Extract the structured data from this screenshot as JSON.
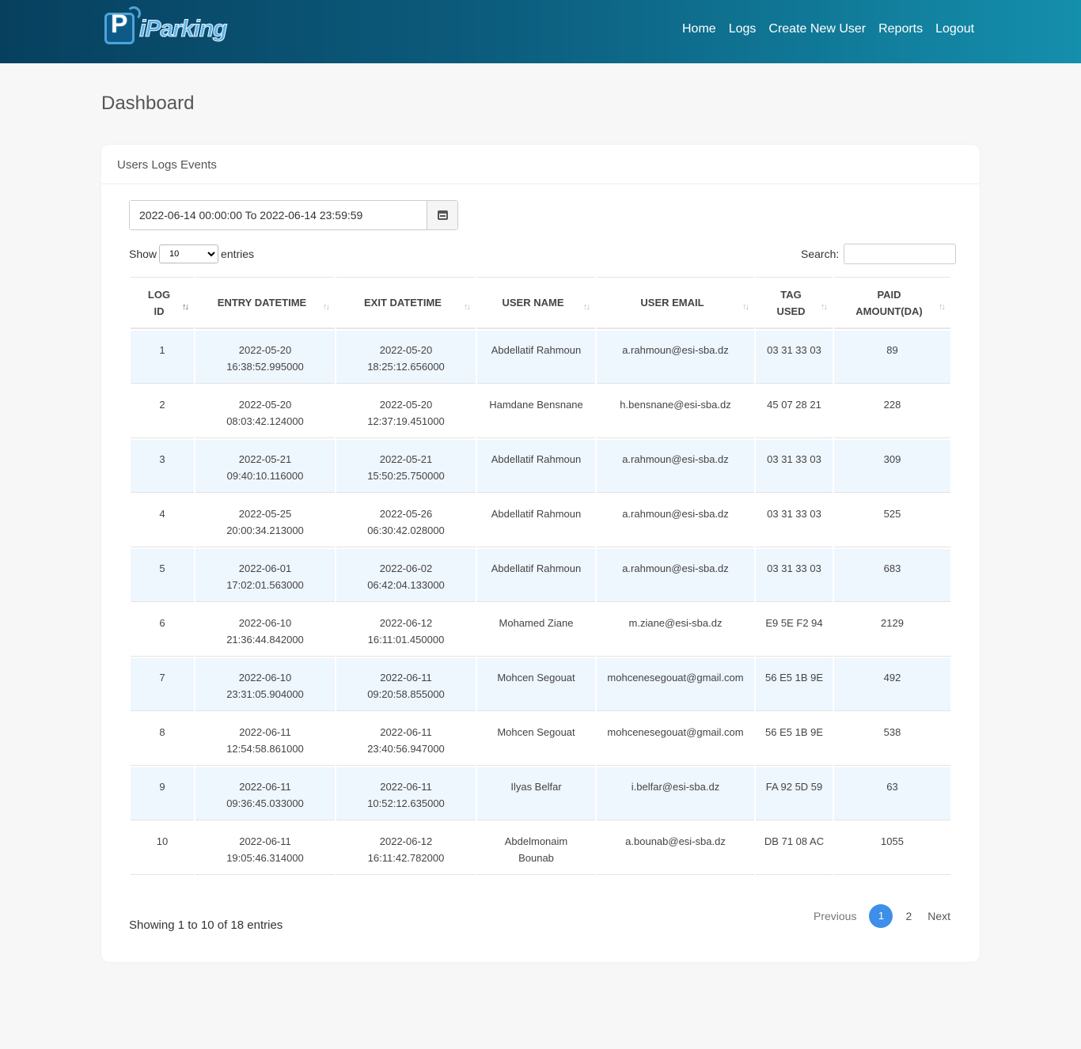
{
  "app": {
    "logo_text": "iParking",
    "logo_letter": "P"
  },
  "nav": {
    "items": [
      {
        "label": "Home"
      },
      {
        "label": "Logs"
      },
      {
        "label": "Create New User"
      },
      {
        "label": "Reports"
      },
      {
        "label": "Logout"
      }
    ]
  },
  "page": {
    "title": "Dashboard"
  },
  "card": {
    "title": "Users Logs Events",
    "daterange_value": "2022-06-14 00:00:00 To 2022-06-14 23:59:59",
    "show_label": "Show",
    "entries_label": "entries",
    "length_selected": "10",
    "search_label": "Search:"
  },
  "table": {
    "headers": [
      {
        "line1": "LOG",
        "line2": "ID"
      },
      {
        "line1": "ENTRY DATETIME",
        "line2": ""
      },
      {
        "line1": "EXIT DATETIME",
        "line2": ""
      },
      {
        "line1": "USER NAME",
        "line2": ""
      },
      {
        "line1": "USER EMAIL",
        "line2": ""
      },
      {
        "line1": "TAG",
        "line2": "USED"
      },
      {
        "line1": "PAID",
        "line2": "AMOUNT(DA)"
      }
    ],
    "rows": [
      {
        "id": "1",
        "entry1": "2022-05-20",
        "entry2": "16:38:52.995000",
        "exit1": "2022-05-20",
        "exit2": "18:25:12.656000",
        "name": "Abdellatif Rahmoun",
        "email": "a.rahmoun@esi-sba.dz",
        "tag": "03 31 33 03",
        "paid": "89"
      },
      {
        "id": "2",
        "entry1": "2022-05-20",
        "entry2": "08:03:42.124000",
        "exit1": "2022-05-20",
        "exit2": "12:37:19.451000",
        "name": "Hamdane Bensnane",
        "email": "h.bensnane@esi-sba.dz",
        "tag": "45 07 28 21",
        "paid": "228"
      },
      {
        "id": "3",
        "entry1": "2022-05-21",
        "entry2": "09:40:10.116000",
        "exit1": "2022-05-21",
        "exit2": "15:50:25.750000",
        "name": "Abdellatif Rahmoun",
        "email": "a.rahmoun@esi-sba.dz",
        "tag": "03 31 33 03",
        "paid": "309"
      },
      {
        "id": "4",
        "entry1": "2022-05-25",
        "entry2": "20:00:34.213000",
        "exit1": "2022-05-26",
        "exit2": "06:30:42.028000",
        "name": "Abdellatif Rahmoun",
        "email": "a.rahmoun@esi-sba.dz",
        "tag": "03 31 33 03",
        "paid": "525"
      },
      {
        "id": "5",
        "entry1": "2022-06-01",
        "entry2": "17:02:01.563000",
        "exit1": "2022-06-02",
        "exit2": "06:42:04.133000",
        "name": "Abdellatif Rahmoun",
        "email": "a.rahmoun@esi-sba.dz",
        "tag": "03 31 33 03",
        "paid": "683"
      },
      {
        "id": "6",
        "entry1": "2022-06-10",
        "entry2": "21:36:44.842000",
        "exit1": "2022-06-12",
        "exit2": "16:11:01.450000",
        "name": "Mohamed Ziane",
        "email": "m.ziane@esi-sba.dz",
        "tag": "E9 5E F2 94",
        "paid": "2129"
      },
      {
        "id": "7",
        "entry1": "2022-06-10",
        "entry2": "23:31:05.904000",
        "exit1": "2022-06-11",
        "exit2": "09:20:58.855000",
        "name": "Mohcen Segouat",
        "email": "mohcenesegouat@gmail.com",
        "tag": "56 E5 1B 9E",
        "paid": "492"
      },
      {
        "id": "8",
        "entry1": "2022-06-11",
        "entry2": "12:54:58.861000",
        "exit1": "2022-06-11",
        "exit2": "23:40:56.947000",
        "name": "Mohcen Segouat",
        "email": "mohcenesegouat@gmail.com",
        "tag": "56 E5 1B 9E",
        "paid": "538"
      },
      {
        "id": "9",
        "entry1": "2022-06-11",
        "entry2": "09:36:45.033000",
        "exit1": "2022-06-11",
        "exit2": "10:52:12.635000",
        "name": "Ilyas Belfar",
        "email": "i.belfar@esi-sba.dz",
        "tag": "FA 92 5D 59",
        "paid": "63"
      },
      {
        "id": "10",
        "entry1": "2022-06-11",
        "entry2": "19:05:46.314000",
        "exit1": "2022-06-12",
        "exit2": "16:11:42.782000",
        "name": "Abdelmonaim Bounab",
        "email": "a.bounab@esi-sba.dz",
        "tag": "DB 71 08 AC",
        "paid": "1055"
      }
    ]
  },
  "footer": {
    "info": "Showing 1 to 10 of 18 entries",
    "pager": {
      "previous": "Previous",
      "pages": [
        "1",
        "2"
      ],
      "next": "Next"
    }
  }
}
